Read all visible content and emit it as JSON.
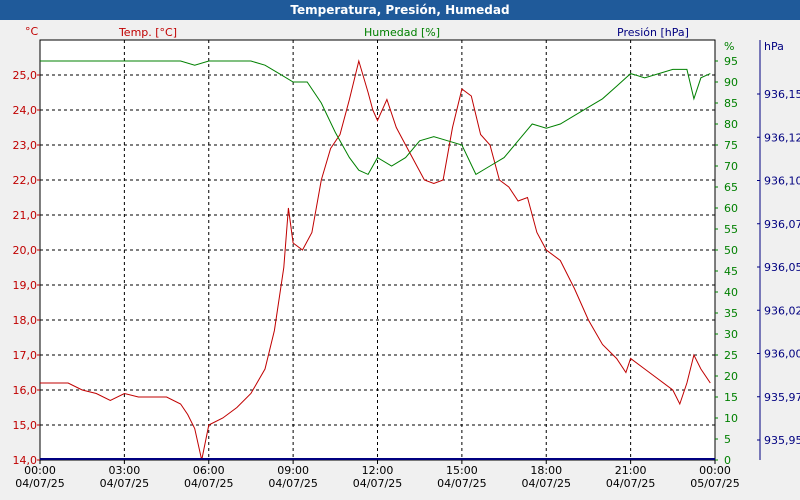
{
  "window": {
    "title": "Temperatura, Presión, Humedad"
  },
  "colors": {
    "temp": "#c00000",
    "humidity": "#008000",
    "pressure": "#000080",
    "grid": "#000000",
    "plot_bg": "#ffffff"
  },
  "chart_data": {
    "type": "line",
    "title": "Temperatura, Presión, Humedad",
    "grid": true,
    "legend": "top",
    "x_ticks": [
      {
        "time": "00:00",
        "date": "04/07/25"
      },
      {
        "time": "03:00",
        "date": "04/07/25"
      },
      {
        "time": "06:00",
        "date": "04/07/25"
      },
      {
        "time": "09:00",
        "date": "04/07/25"
      },
      {
        "time": "12:00",
        "date": "04/07/25"
      },
      {
        "time": "15:00",
        "date": "04/07/25"
      },
      {
        "time": "18:00",
        "date": "04/07/25"
      },
      {
        "time": "21:00",
        "date": "04/07/25"
      },
      {
        "time": "00:00",
        "date": "05/07/25"
      }
    ],
    "xlim": [
      "04/07/25 00:00",
      "05/07/25 00:00"
    ],
    "axes": {
      "temp": {
        "label": "Temp. [°C]",
        "unit": "°C",
        "ylim": [
          14.0,
          26.0
        ],
        "ticks": [
          "14,0",
          "15,0",
          "16,0",
          "17,0",
          "18,0",
          "19,0",
          "20,0",
          "21,0",
          "22,0",
          "23,0",
          "24,0",
          "25,0"
        ]
      },
      "humidity": {
        "label": "Humedad [%]",
        "unit": "%",
        "ylim": [
          0,
          100
        ],
        "ticks": [
          "0",
          "5",
          "10",
          "15",
          "20",
          "25",
          "30",
          "35",
          "40",
          "45",
          "50",
          "55",
          "60",
          "65",
          "70",
          "75",
          "80",
          "85",
          "90",
          "95"
        ]
      },
      "pressure": {
        "label": "Presión [hPa]",
        "unit": "hPa",
        "ylim": [
          935.95,
          936.15
        ],
        "ticks": [
          "935,95",
          "935,97",
          "936,00",
          "936,02",
          "936,05",
          "936,07",
          "936,10",
          "936,12",
          "936,15"
        ]
      }
    },
    "series": [
      {
        "name": "Temp. [°C]",
        "axis": "temp",
        "x": [
          "00:00",
          "00:30",
          "01:00",
          "01:30",
          "02:00",
          "02:30",
          "03:00",
          "03:30",
          "04:00",
          "04:30",
          "05:00",
          "05:15",
          "05:30",
          "05:45",
          "06:00",
          "06:30",
          "07:00",
          "07:30",
          "08:00",
          "08:20",
          "08:40",
          "08:50",
          "09:00",
          "09:20",
          "09:40",
          "10:00",
          "10:20",
          "10:40",
          "11:00",
          "11:20",
          "11:40",
          "11:50",
          "12:00",
          "12:20",
          "12:40",
          "13:00",
          "13:20",
          "13:40",
          "14:00",
          "14:20",
          "14:40",
          "15:00",
          "15:20",
          "15:40",
          "16:00",
          "16:20",
          "16:40",
          "17:00",
          "17:20",
          "17:40",
          "18:00",
          "18:30",
          "19:00",
          "19:30",
          "20:00",
          "20:30",
          "20:50",
          "21:00",
          "21:30",
          "22:00",
          "22:30",
          "22:45",
          "23:00",
          "23:15",
          "23:30",
          "23:50"
        ],
        "y": [
          16.2,
          16.2,
          16.2,
          16.0,
          15.9,
          15.7,
          15.9,
          15.8,
          15.8,
          15.8,
          15.6,
          15.3,
          14.9,
          14.0,
          15.0,
          15.2,
          15.5,
          15.9,
          16.6,
          17.7,
          19.5,
          21.2,
          20.2,
          20.0,
          20.5,
          22.0,
          22.9,
          23.3,
          24.3,
          25.4,
          24.5,
          24.0,
          23.7,
          24.3,
          23.5,
          23.0,
          22.5,
          22.0,
          21.9,
          22.0,
          23.5,
          24.6,
          24.4,
          23.3,
          23.0,
          22.0,
          21.8,
          21.4,
          21.5,
          20.5,
          20.0,
          19.7,
          18.9,
          18.0,
          17.3,
          16.9,
          16.5,
          16.9,
          16.6,
          16.3,
          16.0,
          15.6,
          16.2,
          17.0,
          16.6,
          16.2
        ]
      },
      {
        "name": "Humedad [%]",
        "axis": "humidity",
        "x": [
          "00:00",
          "01:00",
          "02:00",
          "03:00",
          "04:00",
          "05:00",
          "05:30",
          "06:00",
          "06:30",
          "07:00",
          "07:30",
          "08:00",
          "08:30",
          "09:00",
          "09:30",
          "10:00",
          "10:30",
          "11:00",
          "11:20",
          "11:40",
          "12:00",
          "12:30",
          "13:00",
          "13:30",
          "14:00",
          "14:30",
          "15:00",
          "15:30",
          "16:00",
          "16:30",
          "17:00",
          "17:30",
          "18:00",
          "18:30",
          "19:00",
          "19:30",
          "20:00",
          "20:30",
          "21:00",
          "21:30",
          "22:00",
          "22:30",
          "23:00",
          "23:15",
          "23:30",
          "23:50"
        ],
        "y": [
          95,
          95,
          95,
          95,
          95,
          95,
          94,
          95,
          95,
          95,
          95,
          94,
          92,
          90,
          90,
          85,
          78,
          72,
          69,
          68,
          72,
          70,
          72,
          76,
          77,
          76,
          75,
          68,
          70,
          72,
          76,
          80,
          79,
          80,
          82,
          84,
          86,
          89,
          92,
          91,
          92,
          93,
          93,
          86,
          91,
          92
        ]
      },
      {
        "name": "Presión [hPa]",
        "axis": "pressure",
        "x": [
          "00:00",
          "24:00"
        ],
        "y": [
          935.953,
          935.953
        ]
      }
    ]
  }
}
